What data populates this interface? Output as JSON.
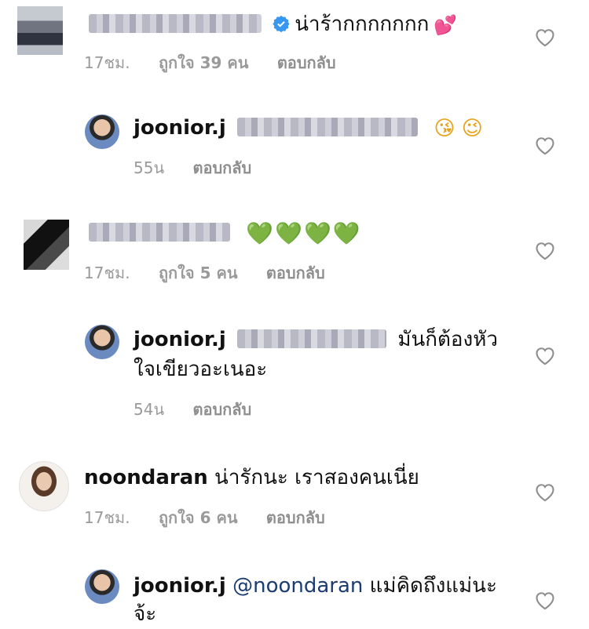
{
  "comments": [
    {
      "text": "น่าร้ากกกกกกก",
      "time": "17ชม.",
      "likes": "ถูกใจ 39 คน",
      "reply": "ตอบกลับ",
      "verified": true,
      "emoji": "💕"
    },
    {
      "username": "joonior.j",
      "text": "",
      "time": "55น",
      "reply": "ตอบกลับ",
      "emoji": "😘 😉"
    },
    {
      "text": "",
      "time": "17ชม.",
      "likes": "ถูกใจ 5 คน",
      "reply": "ตอบกลับ",
      "emoji": "💚💚💚💚"
    },
    {
      "username": "joonior.j",
      "text_line1": "มันก็ต้องหัว",
      "text_line2": "ใจเขียวอะเนอะ",
      "time": "54น",
      "reply": "ตอบกลับ"
    },
    {
      "username": "noondaran",
      "text": "น่ารักนะ เราสองคนเนี่ย",
      "time": "17ชม.",
      "likes": "ถูกใจ 6 คน",
      "reply": "ตอบกลับ"
    },
    {
      "username": "joonior.j",
      "mention": "@noondaran",
      "text_line1": "แม่คิดถึงแม่นะ",
      "text_line2": "จ้ะ"
    }
  ],
  "icons": {
    "like": "heart-outline-icon",
    "verified": "verified-badge-icon"
  }
}
